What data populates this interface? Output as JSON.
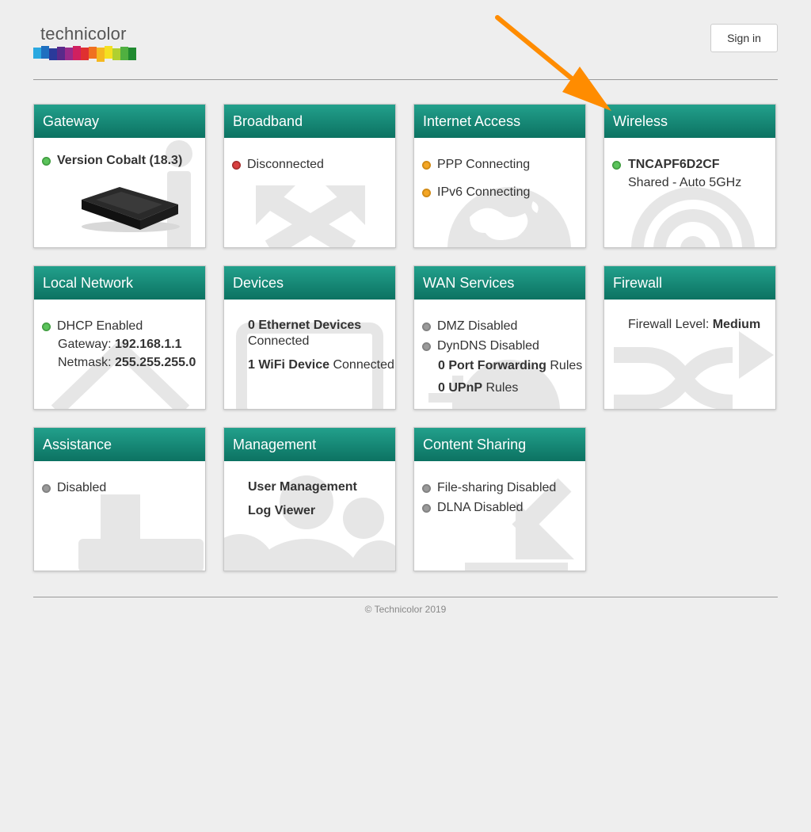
{
  "header": {
    "logo_text": "technicolor",
    "signin_label": "Sign in"
  },
  "cards": {
    "gateway": {
      "title": "Gateway",
      "version": "Version Cobalt (18.3)"
    },
    "broadband": {
      "title": "Broadband",
      "status": "Disconnected"
    },
    "internet": {
      "title": "Internet Access",
      "ppp": "PPP Connecting",
      "ipv6": "IPv6 Connecting"
    },
    "wireless": {
      "title": "Wireless",
      "ssid": "TNCAPF6D2CF",
      "mode": "Shared - Auto 5GHz"
    },
    "local": {
      "title": "Local Network",
      "dhcp": "DHCP Enabled",
      "gateway_label": "Gateway:",
      "gateway_value": "192.168.1.1",
      "netmask_label": "Netmask:",
      "netmask_value": "255.255.255.0"
    },
    "devices": {
      "title": "Devices",
      "ethernet_count": "0 Ethernet Devices",
      "ethernet_suffix": "Connected",
      "wifi_count": "1 WiFi Device",
      "wifi_suffix": "Connected"
    },
    "wan": {
      "title": "WAN Services",
      "dmz": "DMZ Disabled",
      "dyndns": "DynDNS Disabled",
      "portfwd_count": "0 Port Forwarding",
      "portfwd_suffix": "Rules",
      "upnp_count": "0 UPnP",
      "upnp_suffix": "Rules"
    },
    "firewall": {
      "title": "Firewall",
      "level_label": "Firewall Level:",
      "level_value": "Medium"
    },
    "assistance": {
      "title": "Assistance",
      "status": "Disabled"
    },
    "management": {
      "title": "Management",
      "user_mgmt": "User Management",
      "log_viewer": "Log Viewer"
    },
    "content": {
      "title": "Content Sharing",
      "filesharing": "File-sharing Disabled",
      "dlna": "DLNA Disabled"
    }
  },
  "footer": {
    "copyright": "© Technicolor 2019"
  },
  "colors": {
    "header_green_top": "#22a08c",
    "header_green_bottom": "#0c7262",
    "status_green": "#5bc45b",
    "status_red": "#d94040",
    "status_orange": "#f5a623",
    "status_gray": "#9a9a9a",
    "annotation_arrow": "#ff8c00"
  }
}
